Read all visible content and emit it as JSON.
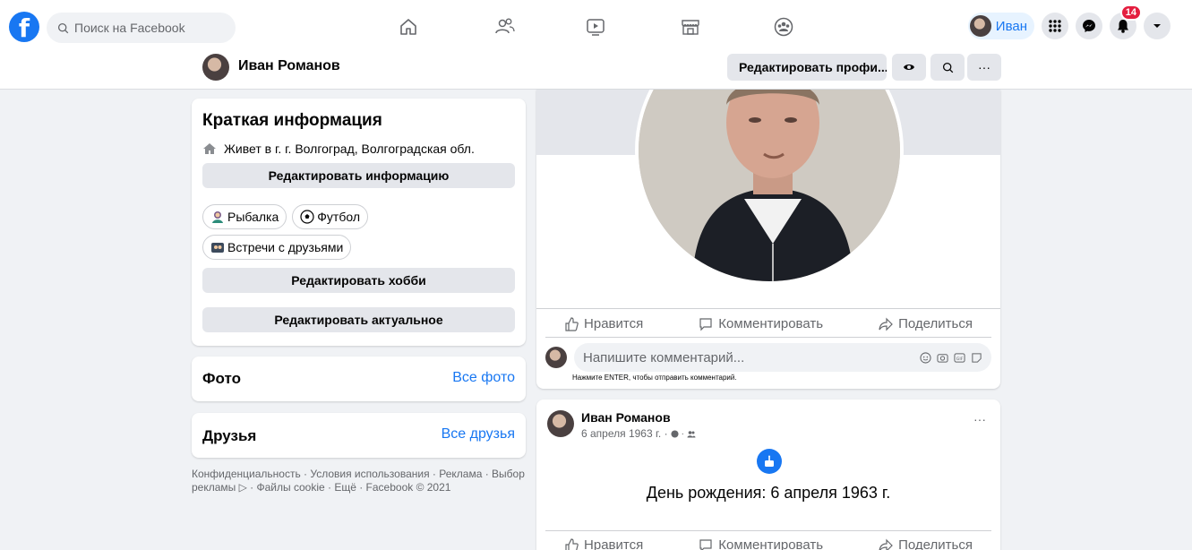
{
  "header": {
    "logo_letter": "f",
    "search_placeholder": "Поиск на Facebook",
    "nav_icons": [
      "home-icon",
      "friends-icon",
      "watch-icon",
      "marketplace-icon",
      "groups-icon"
    ],
    "profile_name": "Иван",
    "notifications_count": "14"
  },
  "profile_bar": {
    "name": "Иван Романов",
    "edit_profile": "Редактировать профи...",
    "more": "···"
  },
  "intro": {
    "title": "Краткая информация",
    "lives_in": "Живет в г. г. Волгоград, Волгоградская обл.",
    "edit_info": "Редактировать информацию",
    "hobbies": [
      "Рыбалка",
      "Футбол",
      "Встречи с друзьями"
    ],
    "edit_hobbies": "Редактировать хобби",
    "edit_featured": "Редактировать актуальное"
  },
  "photos": {
    "title": "Фото",
    "link": "Все фото"
  },
  "friends": {
    "title": "Друзья",
    "link": "Все друзья"
  },
  "footer": "Конфиденциальность · Условия использования · Реклама · Выбор рекламы ▷ · Файлы cookie · Ещё · Facebook © 2021",
  "actions": {
    "like": "Нравится",
    "comment": "Комментировать",
    "share": "Поделиться"
  },
  "comment": {
    "placeholder": "Напишите комментарий...",
    "hint": "Нажмите ENTER, чтобы отправить комментарий."
  },
  "post": {
    "author": "Иван Романов",
    "date": "6 апреля 1963 г. ·",
    "more": "···",
    "event_text": "День рождения: 6 апреля 1963 г."
  },
  "colors": {
    "accent": "#1877f2",
    "background": "#f0f2f5",
    "badge": "#e41e3f"
  }
}
